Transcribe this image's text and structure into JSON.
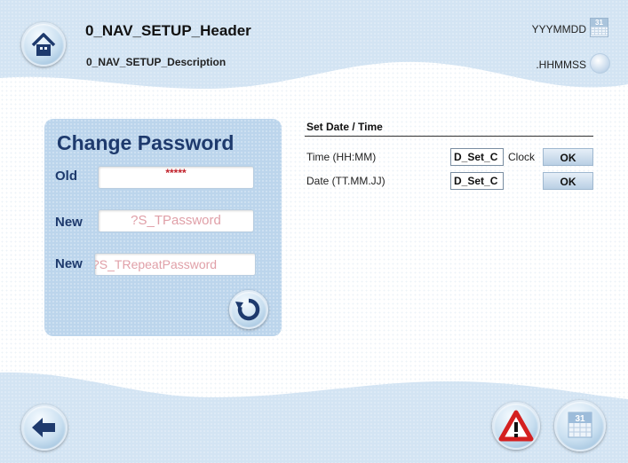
{
  "header": {
    "title": "0_NAV_SETUP_Header",
    "description": "0_NAV_SETUP_Description",
    "date_format": "YYYMMDD",
    "time_format": ".HHMMSS",
    "calendar_day": "31"
  },
  "password_panel": {
    "title": "Change Password",
    "old_label": "Old",
    "old_value": "*****",
    "new_label": "New",
    "new_placeholder": "?S_TPassword",
    "repeat_label": "New",
    "repeat_placeholder": "?S_TRepeatPassword"
  },
  "datetime_panel": {
    "title": "Set Date / Time",
    "time_label": "Time (HH:MM)",
    "time_value": "D_Set_C",
    "clock_label": "Clock",
    "time_ok": "OK",
    "date_label": "Date (TT.MM.JJ)",
    "date_value": "D_Set_C",
    "date_ok": "OK"
  },
  "footer": {
    "calendar_day": "31"
  },
  "colors": {
    "panel_bg": "#bcd5ec",
    "panel_text": "#1e3a6d",
    "placeholder_text": "#e0a0a8",
    "password_dots": "#c0202a",
    "wave_blue": "#cfe1f1",
    "warning_red": "#d42020"
  },
  "icons": {
    "home": "home-icon",
    "back": "back-arrow-icon",
    "reset": "refresh-icon",
    "warning": "warning-icon",
    "calendar": "calendar-icon",
    "clock": "clock-icon"
  }
}
